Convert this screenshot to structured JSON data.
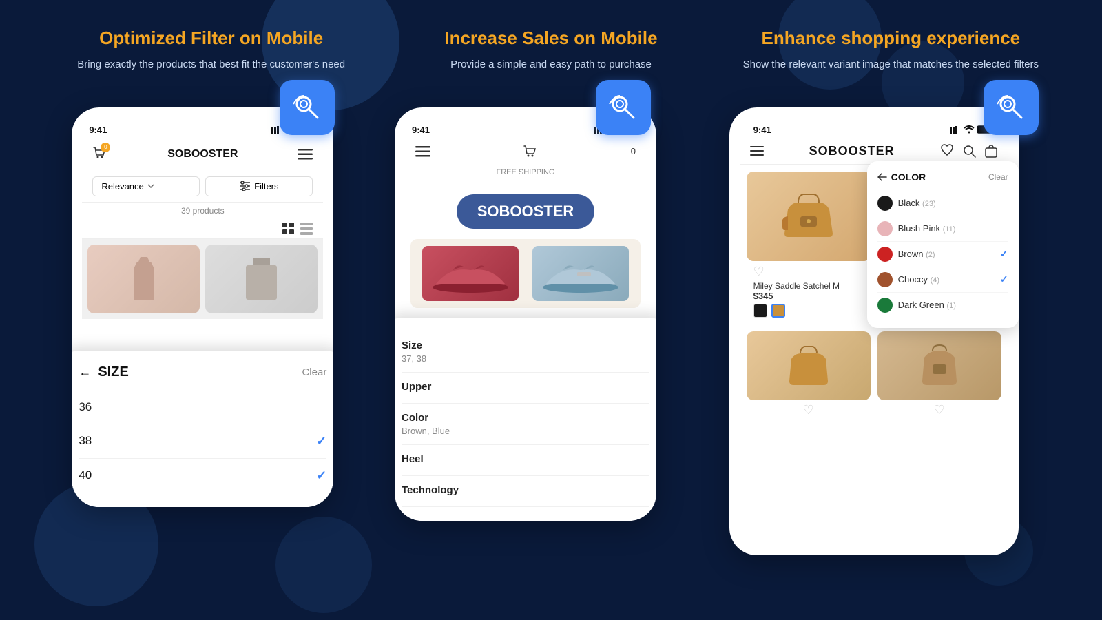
{
  "background": "#0a1a3a",
  "sections": [
    {
      "id": "filter",
      "title": "Optimized Filter on Mobile",
      "description": "Bring exactly the products that best fit the customer's need"
    },
    {
      "id": "sales",
      "title": "Increase Sales on Mobile",
      "description": "Provide a simple and easy path to purchase"
    },
    {
      "id": "enhance",
      "title": "Enhance shopping experience",
      "description": "Show the relevant variant image that matches the selected filters"
    }
  ],
  "phone1": {
    "time": "9:41",
    "store_name": "SOBOOSTER",
    "cart_count": "0",
    "product_count": "39 products",
    "sort_placeholder": "Relevance",
    "filters_label": "Filters",
    "size_filter": {
      "title": "SIZE",
      "clear_label": "Clear",
      "items": [
        {
          "value": "36",
          "selected": false
        },
        {
          "value": "38",
          "selected": true
        },
        {
          "value": "40",
          "selected": true
        }
      ]
    }
  },
  "phone2": {
    "time": "9:41",
    "free_shipping": "FREE SHIPPING",
    "brand": "SOBOOSTER",
    "product_details": [
      {
        "label": "Size",
        "value": "37, 38"
      },
      {
        "label": "Upper",
        "value": ""
      },
      {
        "label": "Color",
        "value": "Brown, Blue"
      },
      {
        "label": "Heel",
        "value": ""
      },
      {
        "label": "Technology",
        "value": ""
      }
    ]
  },
  "phone3": {
    "store_name": "SOBOOSTER",
    "product_name": "Miley Saddle Satchel M",
    "product_price": "$345",
    "color_filter": {
      "title": "COLOR",
      "clear_label": "Clear",
      "items": [
        {
          "name": "Black",
          "count": "23",
          "color": "#1a1a1a",
          "selected": false
        },
        {
          "name": "Blush Pink",
          "count": "11",
          "color": "#e8b4b8",
          "selected": false
        },
        {
          "name": "Brown",
          "count": "2",
          "color": "#cc2222",
          "selected": true
        },
        {
          "name": "Choccy",
          "count": "4",
          "color": "#a0522d",
          "selected": true
        },
        {
          "name": "Dark Green",
          "count": "1",
          "color": "#1a7a3a",
          "selected": false
        }
      ]
    }
  }
}
